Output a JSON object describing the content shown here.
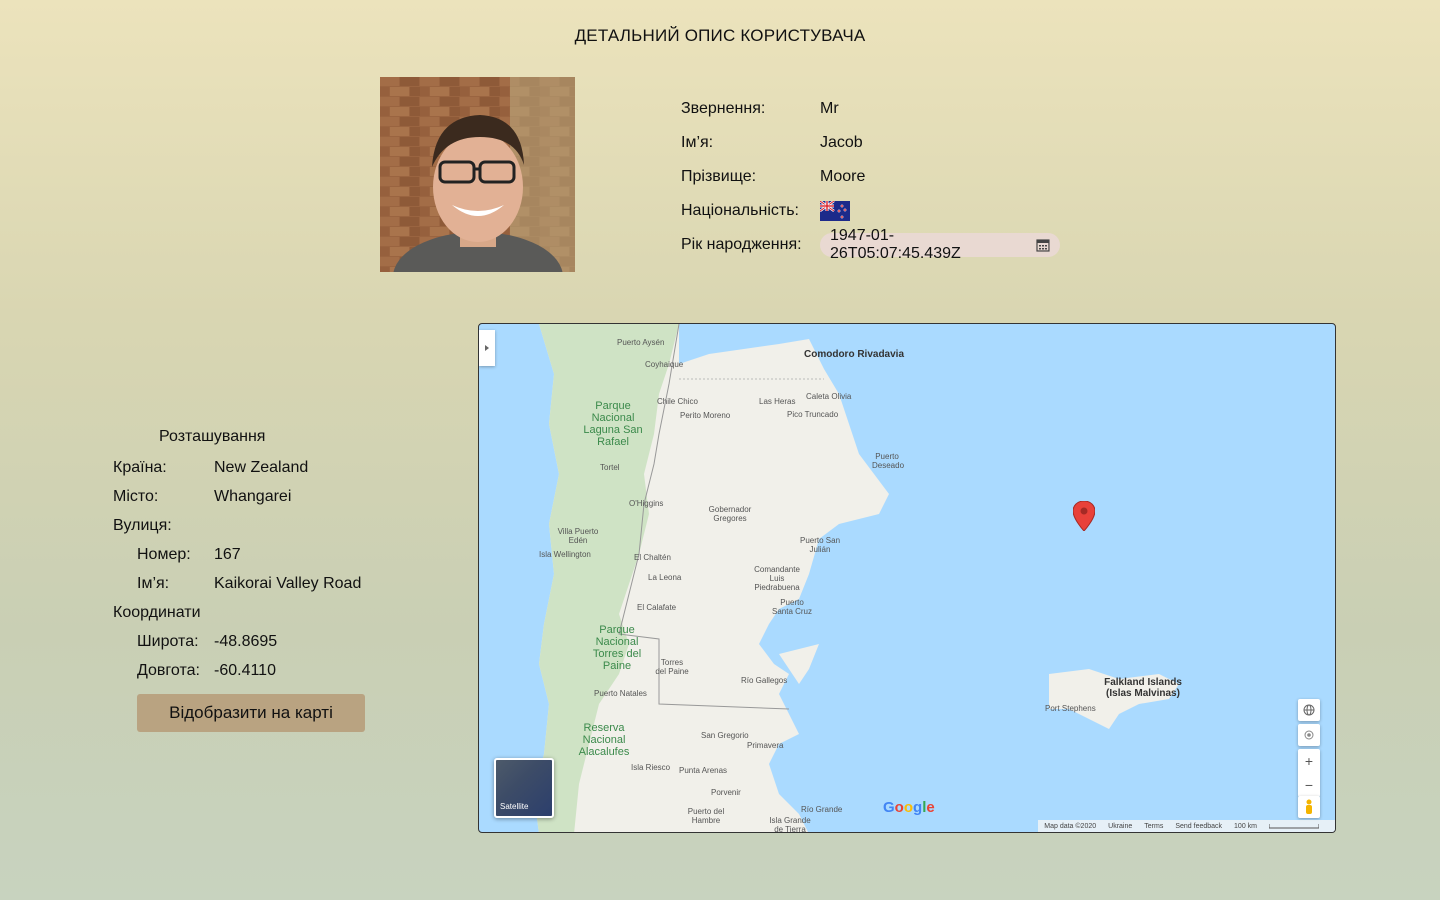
{
  "page": {
    "title": "ДЕТАЛЬНИЙ ОПИС КОРИСТУВАЧА"
  },
  "profile": {
    "photo_alt": "avatar",
    "rows": {
      "title_label": "Звернення:",
      "title_value": "Mr",
      "first_label": "Ім’я:",
      "first_value": "Jacob",
      "last_label": "Прізвище:",
      "last_value": "Moore",
      "nat_label": "Національність:",
      "nat_flag": "flag-nz-icon",
      "birth_label": "Рік народження:",
      "birth_value": "1947-01-26T05:07:45.439Z"
    }
  },
  "location": {
    "heading": "Розташування",
    "country_label": "Країна:",
    "country_value": "New Zealand",
    "city_label": "Місто:",
    "city_value": "Whangarei",
    "street_label": "Вулиця:",
    "number_label": "Номер:",
    "number_value": "167",
    "name_label": "Ім’я:",
    "name_value": "Kaikorai Valley Road",
    "coords_label": "Координати",
    "lat_label": "Широта:",
    "lat_value": "-48.8695",
    "lng_label": "Довгота:",
    "lng_value": "-60.4110",
    "button": "Відобразити на карті"
  },
  "map": {
    "labels": {
      "comodoro": "Comodoro Rivadavia",
      "puerto_aysen": "Puerto Aysén",
      "coyhaique": "Coyhaique",
      "chile_chico": "Chile Chico",
      "perito": "Perito Moreno",
      "las_heras": "Las Heras",
      "caleta": "Caleta Olivia",
      "pico": "Pico Truncado",
      "park1": "Parque Nacional Laguna San Rafael",
      "puerto_deseado": "Puerto Deseado",
      "tortel": "Tortel",
      "ohiggins": "O'Higgins",
      "gobernador": "Gobernador Gregores",
      "villa_puerto": "Villa Puerto Edén",
      "isla_wellington": "Isla Wellington",
      "el_chalten": "El Chaltén",
      "puerto_san_julian": "Puerto San Julián",
      "la_leona": "La Leona",
      "comandante": "Comandante Luis Piedrabuena",
      "el_calafate": "El Calafate",
      "puerto_santa_cruz": "Puerto Santa Cruz",
      "park2": "Parque Nacional Torres del Paine",
      "torres": "Torres del Paine",
      "rio_gallegos": "Río Gallegos",
      "puerto_natales": "Puerto Natales",
      "falkland": "Falkland Islands (Islas Malvinas)",
      "port_stephens": "Port Stephens",
      "park3": "Reserva Nacional Alacalufes",
      "san_gregorio": "San Gregorio",
      "primavera": "Primavera",
      "isla_riesco": "Isla Riesco",
      "punta_arenas": "Punta Arenas",
      "porvenir": "Porvenir",
      "puerto_del_hambre": "Puerto del Hambre",
      "rio_grande": "Río Grande",
      "isla_grande": "Isla Grande de Tierra"
    },
    "satellite_label": "Satellite",
    "google": "Google",
    "attribution": {
      "data": "Map data ©2020",
      "region": "Ukraine",
      "terms": "Terms",
      "feedback": "Send feedback",
      "scale": "100 km"
    }
  }
}
